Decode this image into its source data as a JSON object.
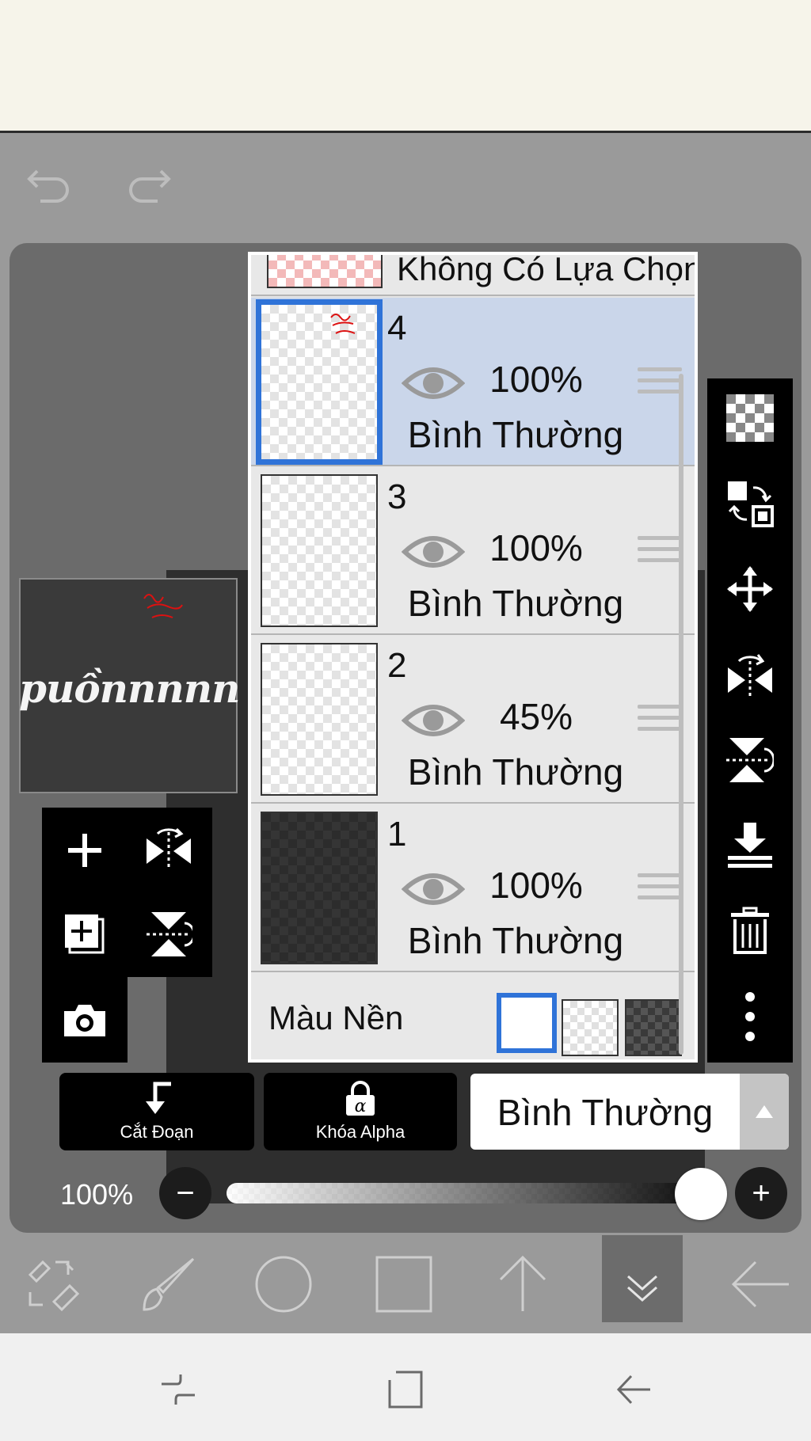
{
  "colors": {
    "accent": "#2f73d8",
    "selected_row": "#cad6ea",
    "panel_bg": "#e8e8e8",
    "toolbar_bg": "#000000"
  },
  "canvas_preview": {
    "title_text": "puồnnnnn"
  },
  "layer_panel": {
    "no_selection_label": "Không Có Lựa Chọn",
    "layers": [
      {
        "number": "4",
        "opacity": "100%",
        "blend": "Bình Thường",
        "selected": true,
        "visibility_icon": "eye-icon"
      },
      {
        "number": "3",
        "opacity": "100%",
        "blend": "Bình Thường",
        "selected": false,
        "visibility_icon": "eye-icon"
      },
      {
        "number": "2",
        "opacity": "45%",
        "blend": "Bình Thường",
        "selected": false,
        "visibility_icon": "eye-icon"
      },
      {
        "number": "1",
        "opacity": "100%",
        "blend": "Bình Thường",
        "selected": false,
        "visibility_icon": "eye-icon"
      }
    ],
    "background": {
      "label": "Màu Nền",
      "options": [
        "white",
        "transparent",
        "dark-checker"
      ],
      "selected": "white"
    }
  },
  "actions": {
    "clip_label": "Cắt Đoạn",
    "alpha_lock_label": "Khóa Alpha",
    "alpha_glyph": "α",
    "blend_mode": "Bình Thường"
  },
  "opacity_slider": {
    "label": "100%",
    "value": 1.0,
    "minus": "−",
    "plus": "+"
  },
  "left_tools": [
    "add-layer-icon",
    "flip-horizontal-icon",
    "add-copy-layer-icon",
    "flip-vertical-icon",
    "camera-icon"
  ],
  "right_tools": [
    "checker-icon",
    "swap-layer-icon",
    "move-icon",
    "flip-horizontal-icon",
    "flip-vertical-icon",
    "merge-down-icon",
    "trash-icon",
    "more-icon"
  ],
  "bottom_toolbar": [
    "transform-icon",
    "brush-icon",
    "circle-icon",
    "square-icon",
    "arrow-up-icon",
    "collapse-icon",
    "back-arrow-icon"
  ],
  "nav_bar": [
    "recent-apps-icon",
    "home-icon",
    "back-icon"
  ]
}
